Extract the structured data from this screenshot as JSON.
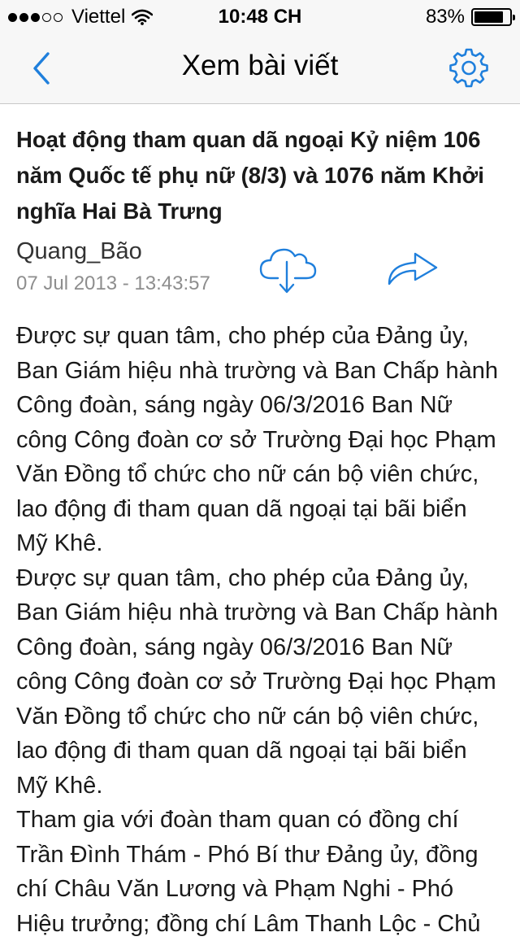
{
  "status_bar": {
    "carrier": "Viettel",
    "time": "10:48 CH",
    "battery": "83%",
    "battery_level": 0.83,
    "signal_bars_filled": 3,
    "signal_bars_total": 5
  },
  "nav": {
    "title": "Xem bài viết",
    "back_icon": "chevron-left-icon",
    "settings_icon": "gear-icon"
  },
  "article": {
    "title": "Hoạt động tham quan dã ngoại Kỷ niệm 106 năm Quốc tế phụ nữ (8/3) và 1076 năm Khởi nghĩa Hai Bà Trưng",
    "author": "Quang_Bão",
    "date": "07 Jul 2013 - 13:43:57",
    "download_icon": "cloud-download-icon",
    "share_icon": "share-icon",
    "paragraphs": [
      "Được sự quan tâm, cho phép của Đảng ủy, Ban Giám hiệu nhà trường và Ban Chấp hành Công đoàn, sáng ngày 06/3/2016 Ban Nữ công Công đoàn cơ sở Trường Đại học Phạm Văn Đồng tổ chức cho nữ cán bộ viên chức, lao động đi tham quan dã ngoại tại bãi biển Mỹ Khê.",
      "Được sự quan tâm, cho phép của Đảng ủy, Ban Giám hiệu nhà trường và Ban Chấp hành Công đoàn, sáng ngày 06/3/2016 Ban Nữ công Công đoàn cơ sở Trường Đại học Phạm Văn Đồng tổ chức cho nữ cán bộ viên chức, lao động đi tham quan dã ngoại tại bãi biển Mỹ Khê.",
      "Tham gia với đoàn tham quan có đồng chí Trần Đình Thám - Phó Bí thư Đảng ủy, đồng chí Châu Văn Lương và Phạm Nghi - Phó Hiệu trưởng; đồng chí Lâm Thanh Lộc - Chủ"
    ]
  },
  "colors": {
    "accent": "#1f7fdc",
    "bar_background": "#f7f7f7",
    "date_text": "#8e8e8e",
    "body_text": "#1a1a1a"
  }
}
